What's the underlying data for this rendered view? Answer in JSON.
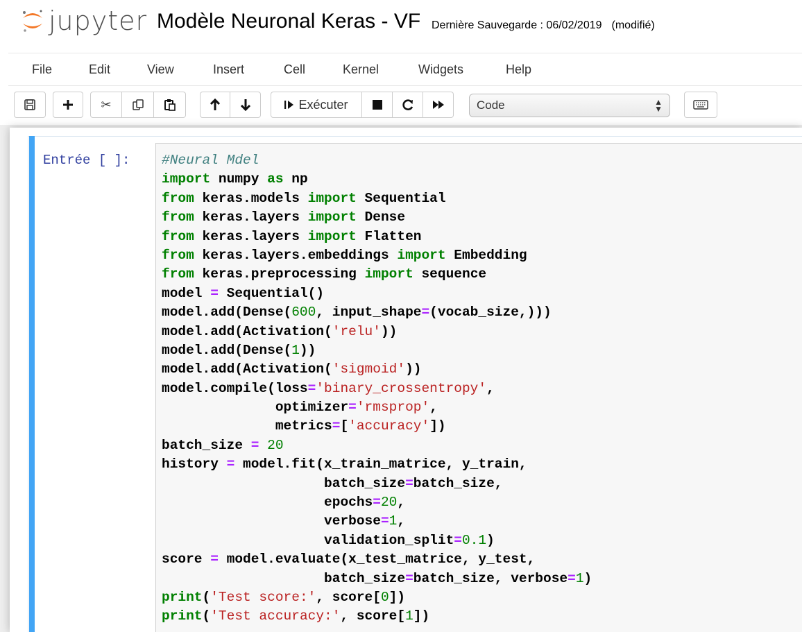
{
  "header": {
    "logo_text": "jupyter",
    "notebook_name": "Modèle Neuronal Keras - VF",
    "save_label": "Dernière Sauvegarde : 06/02/2019",
    "save_status": "(modifié)"
  },
  "menu": {
    "file": "File",
    "edit": "Edit",
    "view": "View",
    "insert": "Insert",
    "cell": "Cell",
    "kernel": "Kernel",
    "widgets": "Widgets",
    "help": "Help"
  },
  "toolbar": {
    "run_label": "Exécuter",
    "cell_type": "Code",
    "icons": [
      "save-icon",
      "plus-icon",
      "cut-icon",
      "copy-icon",
      "paste-icon",
      "arrow-up-icon",
      "arrow-down-icon",
      "run-icon",
      "stop-icon",
      "restart-icon",
      "fast-forward-icon",
      "keyboard-icon"
    ]
  },
  "cell": {
    "prompt": "Entrée [ ]:",
    "lines": [
      [
        [
          "cm",
          "#Neural Mdel"
        ]
      ],
      [
        [
          "kw",
          "import"
        ],
        [
          "plain",
          " numpy "
        ],
        [
          "kw",
          "as"
        ],
        [
          "plain",
          " np"
        ]
      ],
      [
        [
          "kw",
          "from"
        ],
        [
          "plain",
          " keras.models "
        ],
        [
          "kw",
          "import"
        ],
        [
          "plain",
          " Sequential"
        ]
      ],
      [
        [
          "kw",
          "from"
        ],
        [
          "plain",
          " keras.layers "
        ],
        [
          "kw",
          "import"
        ],
        [
          "plain",
          " Dense"
        ]
      ],
      [
        [
          "kw",
          "from"
        ],
        [
          "plain",
          " keras.layers "
        ],
        [
          "kw",
          "import"
        ],
        [
          "plain",
          " Flatten"
        ]
      ],
      [
        [
          "kw",
          "from"
        ],
        [
          "plain",
          " keras.layers.embeddings "
        ],
        [
          "kw",
          "import"
        ],
        [
          "plain",
          " Embedding"
        ]
      ],
      [
        [
          "kw",
          "from"
        ],
        [
          "plain",
          " keras.preprocessing "
        ],
        [
          "kw",
          "import"
        ],
        [
          "plain",
          " sequence"
        ]
      ],
      [
        [
          "plain",
          "model "
        ],
        [
          "op",
          "="
        ],
        [
          "plain",
          " Sequential()"
        ]
      ],
      [
        [
          "plain",
          "model.add(Dense("
        ],
        [
          "num",
          "600"
        ],
        [
          "plain",
          ", input_shape"
        ],
        [
          "op",
          "="
        ],
        [
          "plain",
          "(vocab_size,)))"
        ]
      ],
      [
        [
          "plain",
          "model.add(Activation("
        ],
        [
          "str",
          "'relu'"
        ],
        [
          "plain",
          "))"
        ]
      ],
      [
        [
          "plain",
          "model.add(Dense("
        ],
        [
          "num",
          "1"
        ],
        [
          "plain",
          "))"
        ]
      ],
      [
        [
          "plain",
          "model.add(Activation("
        ],
        [
          "str",
          "'sigmoid'"
        ],
        [
          "plain",
          "))"
        ]
      ],
      [
        [
          "plain",
          "model.compile(loss"
        ],
        [
          "op",
          "="
        ],
        [
          "str",
          "'binary_crossentropy'"
        ],
        [
          "plain",
          ","
        ]
      ],
      [
        [
          "plain",
          "              optimizer"
        ],
        [
          "op",
          "="
        ],
        [
          "str",
          "'rmsprop'"
        ],
        [
          "plain",
          ","
        ]
      ],
      [
        [
          "plain",
          "              metrics"
        ],
        [
          "op",
          "="
        ],
        [
          "plain",
          "["
        ],
        [
          "str",
          "'accuracy'"
        ],
        [
          "plain",
          "])"
        ]
      ],
      [
        [
          "plain",
          "batch_size "
        ],
        [
          "op",
          "="
        ],
        [
          "plain",
          " "
        ],
        [
          "num",
          "20"
        ]
      ],
      [
        [
          "plain",
          "history "
        ],
        [
          "op",
          "="
        ],
        [
          "plain",
          " model.fit(x_train_matrice, y_train,"
        ]
      ],
      [
        [
          "plain",
          "                    batch_size"
        ],
        [
          "op",
          "="
        ],
        [
          "plain",
          "batch_size,"
        ]
      ],
      [
        [
          "plain",
          "                    epochs"
        ],
        [
          "op",
          "="
        ],
        [
          "num",
          "20"
        ],
        [
          "plain",
          ","
        ]
      ],
      [
        [
          "plain",
          "                    verbose"
        ],
        [
          "op",
          "="
        ],
        [
          "num",
          "1"
        ],
        [
          "plain",
          ","
        ]
      ],
      [
        [
          "plain",
          "                    validation_split"
        ],
        [
          "op",
          "="
        ],
        [
          "num",
          "0.1"
        ],
        [
          "plain",
          ")"
        ]
      ],
      [
        [
          "plain",
          "score "
        ],
        [
          "op",
          "="
        ],
        [
          "plain",
          " model.evaluate(x_test_matrice, y_test,"
        ]
      ],
      [
        [
          "plain",
          "                    batch_size"
        ],
        [
          "op",
          "="
        ],
        [
          "plain",
          "batch_size, verbose"
        ],
        [
          "op",
          "="
        ],
        [
          "num",
          "1"
        ],
        [
          "plain",
          ")"
        ]
      ],
      [
        [
          "kw",
          "print"
        ],
        [
          "plain",
          "("
        ],
        [
          "str",
          "'Test score:'"
        ],
        [
          "plain",
          ", score["
        ],
        [
          "num",
          "0"
        ],
        [
          "plain",
          "])"
        ]
      ],
      [
        [
          "kw",
          "print"
        ],
        [
          "plain",
          "("
        ],
        [
          "str",
          "'Test accuracy:'"
        ],
        [
          "plain",
          ", score["
        ],
        [
          "num",
          "1"
        ],
        [
          "plain",
          "])"
        ]
      ]
    ]
  }
}
